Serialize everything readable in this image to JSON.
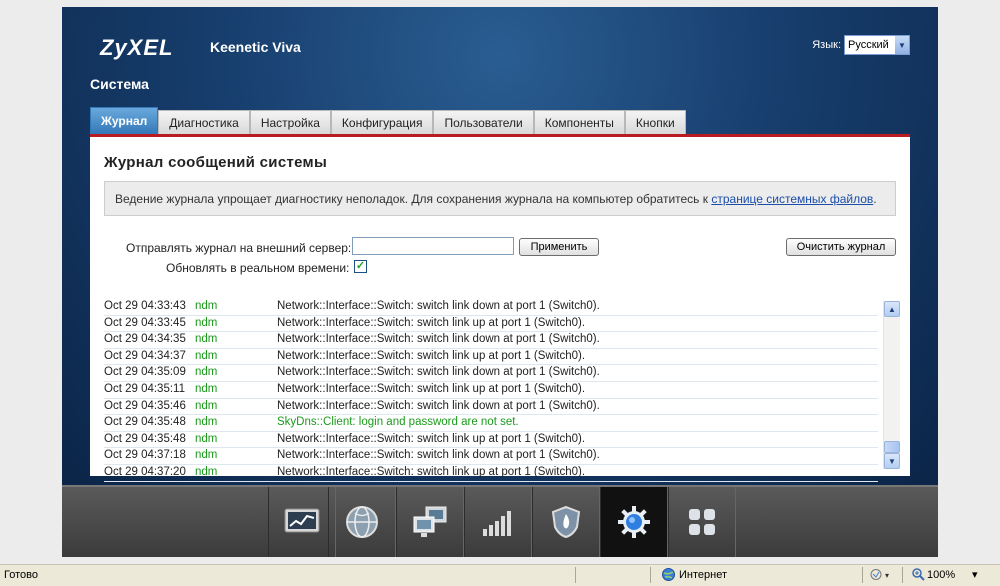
{
  "header": {
    "brand": "ZyXEL",
    "model": "Keenetic Viva",
    "section_title": "Система",
    "lang_label": "Язык:",
    "lang_value": "Русский"
  },
  "tabs": [
    {
      "label": "Журнал",
      "active": true
    },
    {
      "label": "Диагностика",
      "active": false
    },
    {
      "label": "Настройка",
      "active": false
    },
    {
      "label": "Конфигурация",
      "active": false
    },
    {
      "label": "Пользователи",
      "active": false
    },
    {
      "label": "Компоненты",
      "active": false
    },
    {
      "label": "Кнопки",
      "active": false
    }
  ],
  "log_page": {
    "title": "Журнал сообщений системы",
    "info_text": "Ведение журнала упрощает диагностику неполадок. Для сохранения журнала на компьютер обратитесь к ",
    "info_link": "странице системных файлов",
    "info_end": ".",
    "server_label": "Отправлять журнал на внешний сервер:",
    "server_value": "",
    "apply_label": "Применить",
    "clear_label": "Очистить журнал",
    "realtime_label": "Обновлять в реальном времени:",
    "realtime_checked": true
  },
  "log_entries": [
    {
      "time": "Oct 29 04:33:43",
      "source": "ndm",
      "message": "Network::Interface::Switch: switch link down at port 1 (Switch0).",
      "highlight": false
    },
    {
      "time": "Oct 29 04:33:45",
      "source": "ndm",
      "message": "Network::Interface::Switch: switch link up at port 1 (Switch0).",
      "highlight": false
    },
    {
      "time": "Oct 29 04:34:35",
      "source": "ndm",
      "message": "Network::Interface::Switch: switch link down at port 1 (Switch0).",
      "highlight": false
    },
    {
      "time": "Oct 29 04:34:37",
      "source": "ndm",
      "message": "Network::Interface::Switch: switch link up at port 1 (Switch0).",
      "highlight": false
    },
    {
      "time": "Oct 29 04:35:09",
      "source": "ndm",
      "message": "Network::Interface::Switch: switch link down at port 1 (Switch0).",
      "highlight": false
    },
    {
      "time": "Oct 29 04:35:11",
      "source": "ndm",
      "message": "Network::Interface::Switch: switch link up at port 1 (Switch0).",
      "highlight": false
    },
    {
      "time": "Oct 29 04:35:46",
      "source": "ndm",
      "message": "Network::Interface::Switch: switch link down at port 1 (Switch0).",
      "highlight": false
    },
    {
      "time": "Oct 29 04:35:48",
      "source": "ndm",
      "message": "SkyDns::Client: login and password are not set.",
      "highlight": true
    },
    {
      "time": "Oct 29 04:35:48",
      "source": "ndm",
      "message": "Network::Interface::Switch: switch link up at port 1 (Switch0).",
      "highlight": false
    },
    {
      "time": "Oct 29 04:37:18",
      "source": "ndm",
      "message": "Network::Interface::Switch: switch link down at port 1 (Switch0).",
      "highlight": false
    },
    {
      "time": "Oct 29 04:37:20",
      "source": "ndm",
      "message": "Network::Interface::Switch: switch link up at port 1 (Switch0).",
      "highlight": false
    }
  ],
  "dock": [
    {
      "icon": "monitor-chart-icon",
      "active": false
    },
    {
      "icon": "globe-icon",
      "active": false
    },
    {
      "icon": "network-computers-icon",
      "active": false
    },
    {
      "icon": "wifi-signal-bars-icon",
      "active": false
    },
    {
      "icon": "firewall-shield-icon",
      "active": false
    },
    {
      "icon": "gear-icon",
      "active": true
    },
    {
      "icon": "apps-grid-icon",
      "active": false
    }
  ],
  "statusbar": {
    "status": "Готово",
    "zone": "Интернет",
    "zoom": "100%"
  },
  "colors": {
    "accent_red": "#b81c20",
    "tab_active": "#3478b8",
    "log_green": "#1b9a1b",
    "panel_blue": "#173e6d"
  }
}
